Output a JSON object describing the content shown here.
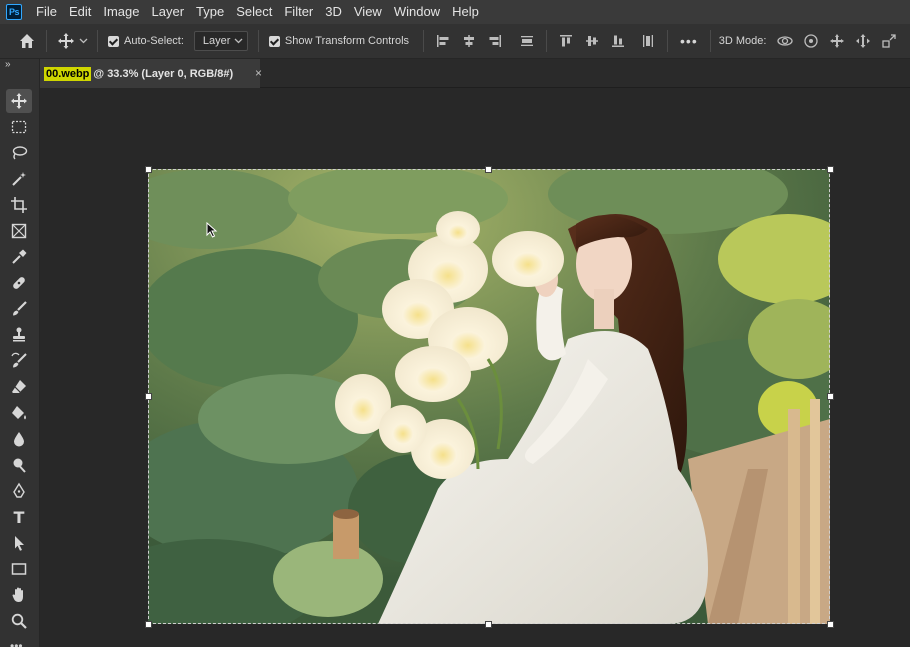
{
  "app": {
    "logo_text": "Ps"
  },
  "menu": [
    "File",
    "Edit",
    "Image",
    "Layer",
    "Type",
    "Select",
    "Filter",
    "3D",
    "View",
    "Window",
    "Help"
  ],
  "options_bar": {
    "auto_select_label": "Auto-Select:",
    "auto_select_checked": true,
    "target_value": "Layer",
    "show_transform_label": "Show Transform Controls",
    "show_transform_checked": true,
    "more_label": "•••",
    "mode_3d_label": "3D Mode:"
  },
  "document_tab": {
    "filename": "00.webp",
    "meta": "@ 33.3% (Layer 0, RGB/8#)",
    "close": "×"
  },
  "tools_panel": {
    "collapse_glyph": "»",
    "more_glyph": "•••",
    "type_tool_glyph": "T",
    "items": [
      "move-tool",
      "rectangular-marquee-tool",
      "lasso-tool",
      "magic-wand-tool",
      "crop-tool",
      "frame-tool",
      "eyedropper-tool",
      "spot-healing-brush-tool",
      "brush-tool",
      "clone-stamp-tool",
      "history-brush-tool",
      "eraser-tool",
      "paint-bucket-tool",
      "blur-tool",
      "dodge-tool",
      "pen-tool",
      "type-tool",
      "path-selection-tool",
      "rectangle-tool",
      "hand-tool",
      "zoom-tool"
    ]
  },
  "colors": {
    "accent_tab_highlight": "#cfd600",
    "menubar_bg": "#3a3a3a",
    "panel_bg": "#323232",
    "canvas_bg": "#282828"
  }
}
